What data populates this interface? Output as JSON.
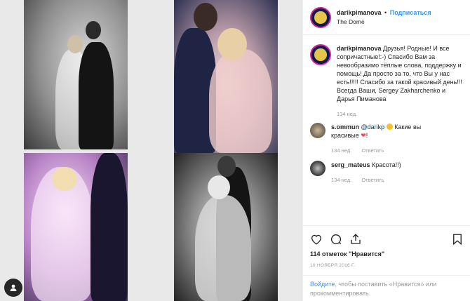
{
  "header": {
    "username": "darikpimanova",
    "separator": "•",
    "follow_label": "Подписаться",
    "location": "The Dome"
  },
  "caption": {
    "username": "darikpimanova",
    "text": "Друзья! Родные! И все сопричастные!:-) Спасибо Вам за невообразимо тёплые слова, поддержку и помощь! Да просто за то, что Вы у нас есть!!!!! Спасибо за такой красивый день!!! Всегда Ваши, Sergey Zakharchenko и Дарья Пиманова",
    "time": "134 нед."
  },
  "comments": [
    {
      "username": "s.ommun",
      "mention": "@darikp",
      "text_before": "Какие вы",
      "text_after": "красивые",
      "end": "!",
      "time": "134 нед.",
      "reply": "Ответить"
    },
    {
      "username": "serg_mateus",
      "text": "Красота!!)",
      "time": "134 нед.",
      "reply": "Ответить"
    }
  ],
  "actions": {
    "like_icon": "heart-icon",
    "comment_icon": "comment-icon",
    "share_icon": "share-icon",
    "save_icon": "bookmark-icon"
  },
  "likes": "114 отметок \"Нравится\"",
  "date": "10 НОЯБРЯ 2016 Г.",
  "login": {
    "link": "Войдите",
    "text": ", чтобы поставить «Нравится» или прокомментировать."
  },
  "colors": {
    "link": "#3897f0",
    "muted": "#999999",
    "text": "#262626",
    "like": "#ed4956"
  }
}
